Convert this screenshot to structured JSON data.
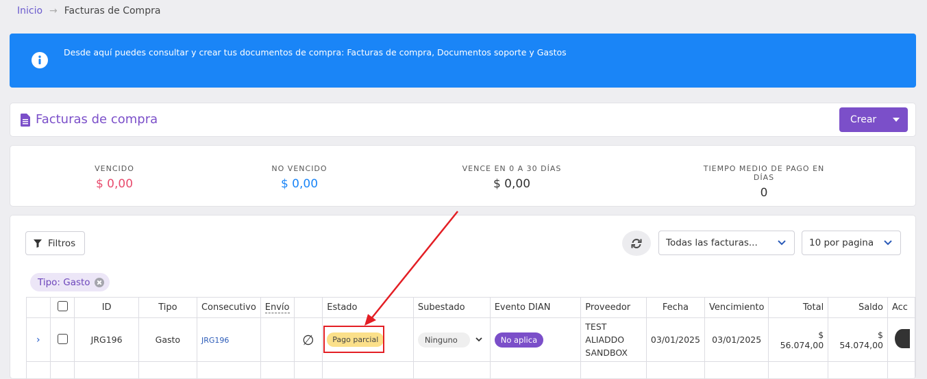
{
  "breadcrumb": {
    "home": "Inicio",
    "separator": "→",
    "current": "Facturas de Compra"
  },
  "banner": {
    "icon": "info-icon",
    "text": "Desde aquí puedes consultar y crear tus documentos de compra: Facturas de compra, Documentos soporte y Gastos"
  },
  "header": {
    "icon": "document-icon",
    "title": "Facturas de compra",
    "create_label": "Crear"
  },
  "stats": [
    {
      "label": "VENCIDO",
      "value": "$ 0,00",
      "color": "#e84c6e"
    },
    {
      "label": "NO VENCIDO",
      "value": "$ 0,00",
      "color": "#1a85f7"
    },
    {
      "label": "VENCE EN 0 A 30 DÍAS",
      "value": "$ 0,00",
      "color": "#333333"
    },
    {
      "label": "TIEMPO MEDIO DE PAGO EN DÍAS",
      "value": "0",
      "color": "#333333"
    }
  ],
  "toolbar": {
    "filters_label": "Filtros",
    "invoices_select": "Todas las facturas...",
    "per_page_select": "10 por pagina"
  },
  "filter_chip": {
    "label": "Tipo: Gasto"
  },
  "table": {
    "columns": [
      "ID",
      "Tipo",
      "Consecutivo",
      "Envío",
      "Estado",
      "Subestado",
      "Evento DIAN",
      "Proveedor",
      "Fecha",
      "Vencimiento",
      "Total",
      "Saldo",
      "Acc"
    ],
    "rows": [
      {
        "expander": "›",
        "id": "JRG196",
        "tipo": "Gasto",
        "consecutivo": "JRG196",
        "envio_symbol": "∅",
        "estado": "Pago parcial",
        "subestado": "Ninguno",
        "evento_dian": "No aplica",
        "proveedor": "TEST ALIADDO SANDBOX",
        "fecha": "03/01/2025",
        "vencimiento": "03/01/2025",
        "total": "$ 56.074,00",
        "saldo": "$ 54.074,00"
      }
    ]
  },
  "colors": {
    "accent": "#7b4fc9",
    "banner": "#1a85f7",
    "highlight": "#e31e24"
  }
}
